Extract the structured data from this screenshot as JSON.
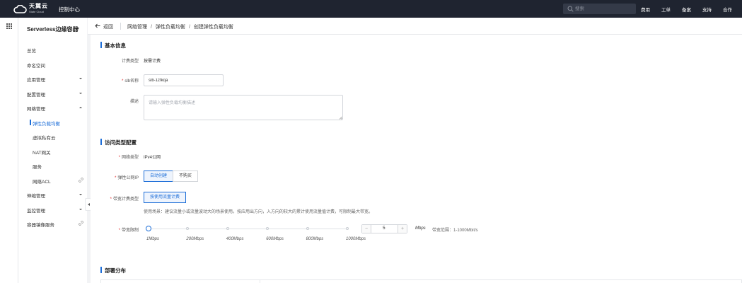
{
  "topbar": {
    "logo_main": "天翼云",
    "logo_sub": "State Cloud",
    "console_label": "控制中心",
    "search_placeholder": "搜索",
    "links": [
      "费用",
      "工单",
      "备案",
      "支持",
      "合作"
    ]
  },
  "sidebar": {
    "title": "Serverless边缘容器",
    "items": [
      {
        "label": "总览"
      },
      {
        "label": "命名空间"
      },
      {
        "label": "应用管理"
      },
      {
        "label": "配置管理"
      },
      {
        "label": "网络管理"
      },
      {
        "label": "弹性负载均衡"
      },
      {
        "label": "虚拟私有云"
      },
      {
        "label": "NAT网关"
      },
      {
        "label": "服务"
      },
      {
        "label": "网络ACL"
      },
      {
        "label": "伸缩管理"
      },
      {
        "label": "监控管理"
      },
      {
        "label": "容器镜像服务"
      }
    ]
  },
  "header": {
    "back_label": "返回",
    "breadcrumb": [
      "网络管理",
      "弹性负载均衡",
      "创建弹性负载均衡"
    ],
    "separator": "/"
  },
  "basic_info": {
    "title": "基本信息",
    "billing_label": "计费类型",
    "billing_value": "按需计费",
    "name_label": "slb名称",
    "name_value": "slb-1zfkqa",
    "desc_label": "描述",
    "desc_placeholder": "请输入弹性负载均衡描述"
  },
  "access_config": {
    "title": "访问类型配置",
    "network_type_label": "网络类型",
    "network_type_value": "IPv4公网",
    "eip_label": "弹性公网IP",
    "eip_options": [
      "自动创建",
      "不购买"
    ],
    "bandwidth_type_label": "带宽计费类型",
    "bandwidth_type_option": "按使用流量计费",
    "usage_hint": "使用场景：建议流量小或流量波动大的场景使用。按应用出方向，入方向的较大的累计使用流量值计费，可限制最大带宽。",
    "bandwidth_limit_label": "带宽限制",
    "slider_marks": [
      "1Mbps",
      "200Mbps",
      "400Mbps",
      "600Mbps",
      "800Mbps",
      "1000Mbps"
    ],
    "bandwidth_value": 5,
    "bandwidth_value_text": "5",
    "stepper_minus": "−",
    "stepper_plus": "+",
    "unit": "Mbps",
    "range_hint": "带宽范围：1-1000Mbit/s"
  },
  "deploy": {
    "title": "部署分布"
  }
}
